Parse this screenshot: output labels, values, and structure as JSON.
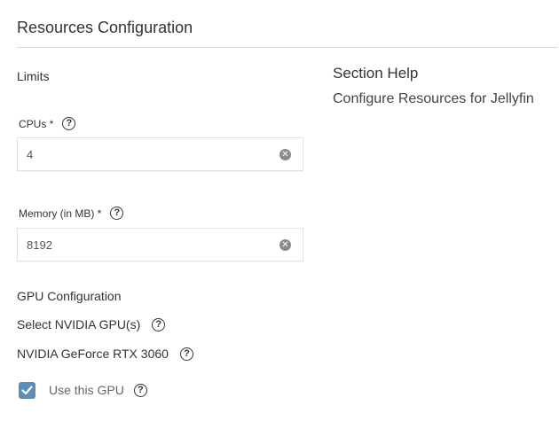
{
  "section": {
    "title": "Resources Configuration",
    "limits_label": "Limits"
  },
  "help": {
    "title": "Section Help",
    "text": "Configure Resources for Jellyfin"
  },
  "cpus": {
    "label": "CPUs *",
    "value": "4"
  },
  "memory": {
    "label": "Memory (in MB) *",
    "value": "8192"
  },
  "gpu": {
    "heading": "GPU Configuration",
    "select_label": "Select NVIDIA GPU(s)",
    "device_name": "NVIDIA GeForce RTX 3060",
    "use_label": "Use this GPU",
    "use_checked": true
  },
  "icons": {
    "help": "help-circle-icon",
    "clear": "clear-circle-icon",
    "check": "check-icon"
  },
  "colors": {
    "checkbox_accent": "#5b8fb9"
  }
}
